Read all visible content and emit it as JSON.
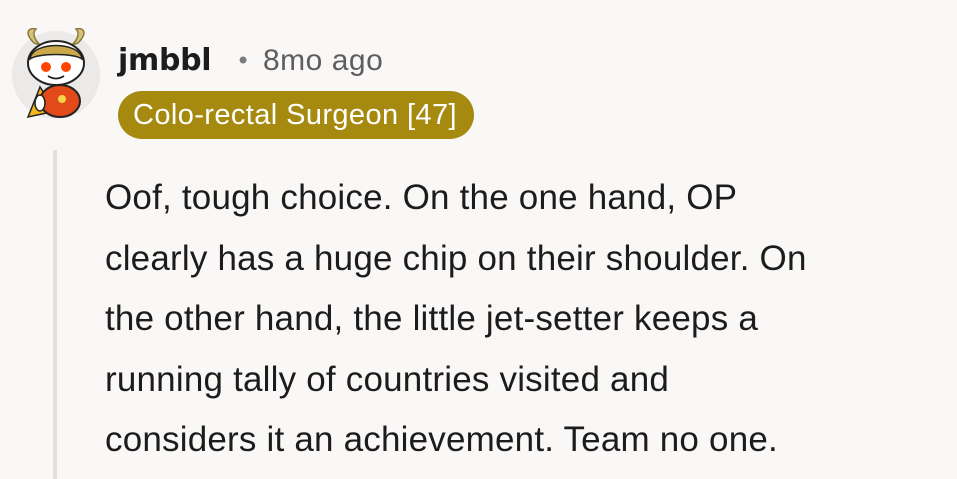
{
  "comment": {
    "username": "jmbbl",
    "separator": "•",
    "timestamp": "8mo ago",
    "flair": "Colo-rectal Surgeon [47]",
    "body_lines": [
      "Oof, tough choice. On the one hand, OP",
      "clearly has a huge chip on their shoulder. On",
      "the other hand, the little jet-setter keeps a",
      "running tally of countries visited and",
      "considers it an achievement. Team no one."
    ]
  },
  "colors": {
    "background": "#faf8f7",
    "flair_background": "#a6890f",
    "flair_text": "#ffffff",
    "thread_line": "#e4e0dc",
    "avatar_accent": "#ff4500"
  },
  "icons": {
    "avatar": "snoo-avatar-icon"
  }
}
